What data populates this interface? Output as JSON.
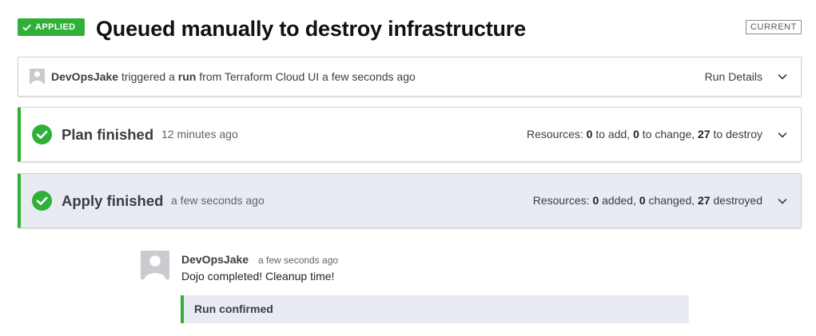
{
  "header": {
    "status_badge": "APPLIED",
    "title": "Queued manually to destroy infrastructure",
    "current_badge": "CURRENT"
  },
  "run": {
    "user": "DevOpsJake",
    "text_triggered": "triggered a",
    "run_word": "run",
    "text_source": "from Terraform Cloud UI a few seconds ago",
    "details_label": "Run Details"
  },
  "plan": {
    "title": "Plan finished",
    "time": "12 minutes ago",
    "resources_label": "Resources:",
    "add": "0",
    "add_text": "to add,",
    "change": "0",
    "change_text": "to change,",
    "destroy": "27",
    "destroy_text": "to destroy"
  },
  "apply": {
    "title": "Apply finished",
    "time": "a few seconds ago",
    "resources_label": "Resources:",
    "added": "0",
    "added_text": "added,",
    "changed": "0",
    "changed_text": "changed,",
    "destroyed": "27",
    "destroyed_text": "destroyed"
  },
  "comment": {
    "author": "DevOpsJake",
    "time": "a few seconds ago",
    "body": "Dojo completed! Cleanup time!",
    "event": "Run confirmed"
  },
  "colors": {
    "success": "#2eb039",
    "highlight_bg": "#e8ebf2"
  },
  "icons": [
    "check-icon",
    "check-circle-icon",
    "chevron-down-icon",
    "user-avatar"
  ]
}
